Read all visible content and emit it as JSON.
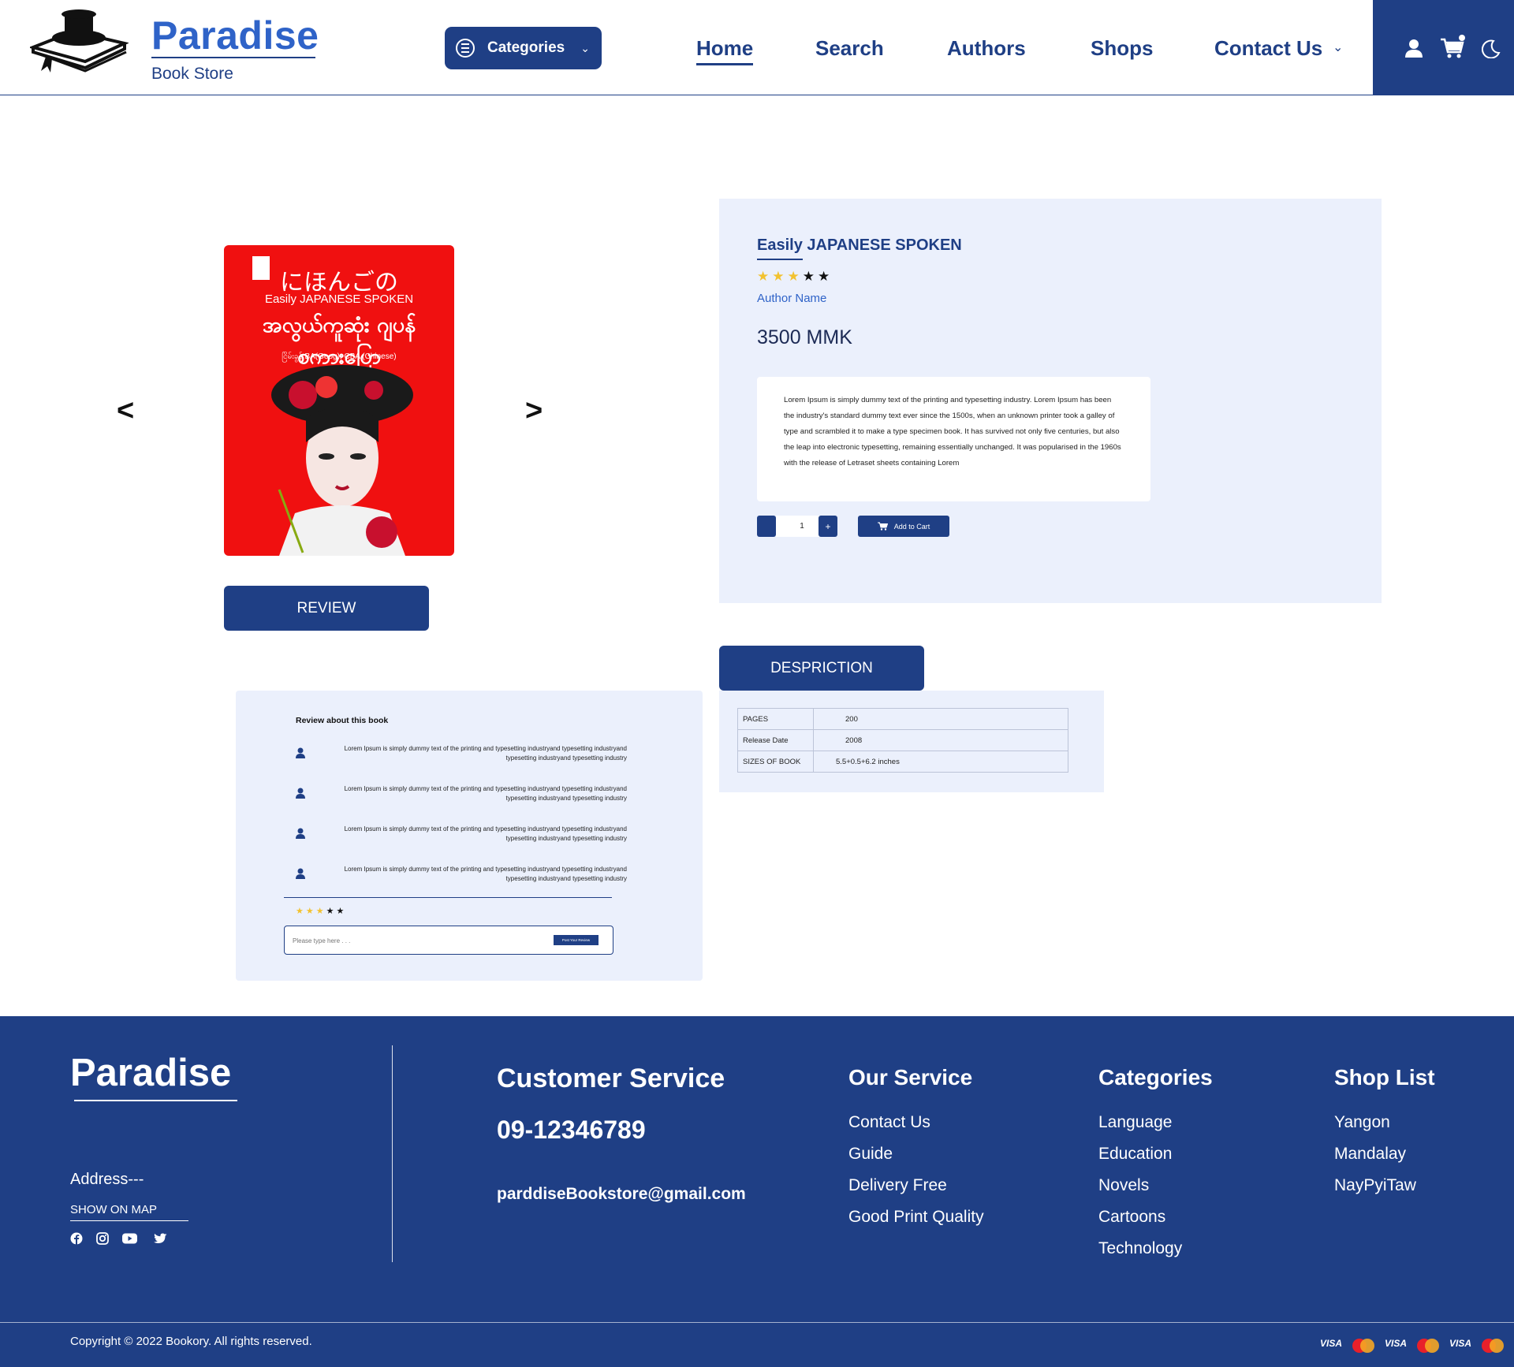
{
  "header": {
    "brand": "Paradise",
    "sub": "Book Store",
    "categories_label": "Categories",
    "nav": [
      "Home",
      "Search",
      "Authors",
      "Shops",
      "Contact Us"
    ],
    "active_nav": "Home"
  },
  "product": {
    "cover": {
      "japanese": "にほんごの",
      "english": "Easily JAPANESE SPOKEN",
      "burmese": "အလွယ်ကူဆုံး ဂျပန်စကားပြော",
      "author_line": "ငြိမ်းခွန် BA(Geog), CBA (Chinese)"
    },
    "title": "Easily JAPANESE SPOKEN",
    "rating": 3,
    "rating_max": 5,
    "author": "Author Name",
    "price": "3500 MMK",
    "description": "Lorem Ipsum is simply dummy text of the printing and typesetting industry. Lorem Ipsum has been the industry's standard dummy text ever since the 1500s, when an unknown printer took a galley of type and scrambled it to make a type specimen book. It has survived not only five centuries, but also the leap into electronic typesetting, remaining essentially unchanged. It was popularised in the 1960s with the release of Letraset sheets containing Lorem",
    "quantity": "1",
    "plus_label": "+",
    "add_to_cart": "Add to Cart",
    "review_button": "REVIEW",
    "description_button": "DESPRICTION"
  },
  "specs": [
    {
      "key": "PAGES",
      "value": "200"
    },
    {
      "key": "Release Date",
      "value": "2008"
    },
    {
      "key": "SIZES OF BOOK",
      "value": "5.5+0.5+6.2 inches"
    }
  ],
  "reviews": {
    "heading": "Review about this book",
    "items": [
      "Lorem Ipsum is simply dummy text of the printing and typesetting industryand typesetting industryand typesetting industryand typesetting industry",
      "Lorem Ipsum is simply dummy text of the printing and typesetting industryand typesetting industryand typesetting industryand typesetting industry",
      "Lorem Ipsum is simply dummy text of the printing and typesetting industryand typesetting industryand typesetting industryand typesetting industry",
      "Lorem Ipsum is simply dummy text of the printing and typesetting industryand typesetting industryand typesetting industryand typesetting industry"
    ],
    "rating": 3,
    "rating_max": 5,
    "placeholder": "Please type here . . .",
    "post_label": "Post Your Review"
  },
  "footer": {
    "brand": "Paradise",
    "address": "Address---",
    "show_on_map": "SHOW ON MAP",
    "social_icons": [
      "facebook-icon",
      "instagram-icon",
      "youtube-icon",
      "twitter-icon"
    ],
    "customer_service": {
      "heading": "Customer Service",
      "phone": "09-12346789",
      "email": "parddiseBookstore@gmail.com"
    },
    "our_service": {
      "heading": "Our Service",
      "items": [
        "Contact Us",
        "Guide",
        "Delivery Free",
        "Good Print Quality"
      ]
    },
    "categories": {
      "heading": "Categories",
      "items": [
        "Language",
        "Education",
        "Novels",
        "Cartoons",
        "Technology"
      ]
    },
    "shop_list": {
      "heading": "Shop List",
      "items": [
        "Yangon",
        "Mandalay",
        "NayPyiTaw"
      ]
    },
    "copyright": "Copyright © 2022 Bookory. All rights reserved.",
    "payment": [
      "VISA",
      "MasterCard",
      "VISA",
      "MasterCard",
      "VISA",
      "MasterCard"
    ]
  },
  "colors": {
    "primary": "#1f3f85",
    "accent": "#2f63c8",
    "panel": "#ebf0fc",
    "star": "#f2c230"
  }
}
